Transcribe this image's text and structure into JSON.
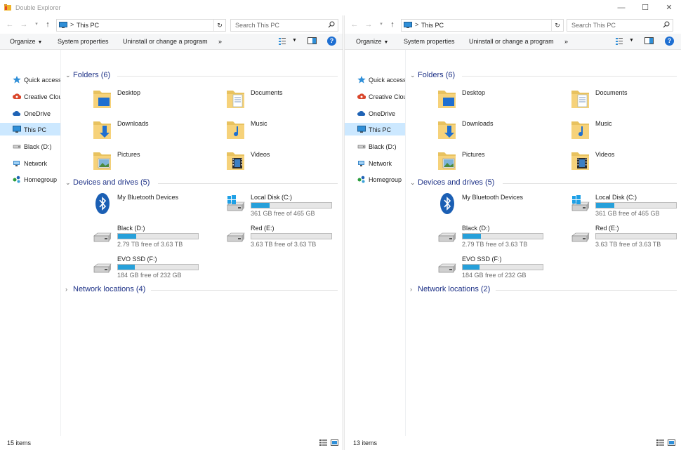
{
  "window": {
    "title": "Double Explorer",
    "controls": {
      "minimize": "—",
      "maximize": "☐",
      "close": "✕"
    }
  },
  "colors": {
    "accent": "#26a0da",
    "section_title": "#1e3287",
    "selected": "#cce8ff",
    "help": "#1e6fd2"
  },
  "panes": [
    {
      "address": {
        "location": "This PC",
        "separator": ">",
        "refresh": "↻"
      },
      "search": {
        "placeholder": "Search This PC"
      },
      "toolbar": {
        "organize": "Organize",
        "system_properties": "System properties",
        "uninstall": "Uninstall or change a program",
        "more": "»",
        "help": "?"
      },
      "nav": [
        "Quick access",
        "Creative Clou",
        "OneDrive",
        "This PC",
        "Black (D:)",
        "Network",
        "Homegroup"
      ],
      "sections": {
        "folders": "Folders (6)",
        "devices": "Devices and drives (5)",
        "network": "Network locations (4)"
      },
      "folders": [
        "Desktop",
        "Documents",
        "Downloads",
        "Music",
        "Pictures",
        "Videos"
      ],
      "devices": {
        "bluetooth": "My Bluetooth Devices",
        "c_name": "Local Disk (C:)",
        "c_free": "361 GB free of 465 GB",
        "c_used": 0.224,
        "d_name": "Black (D:)",
        "d_free": "2.79 TB free of 3.63 TB",
        "d_used": 0.231,
        "e_name": "Red (E:)",
        "e_free": "3.63 TB free of 3.63 TB",
        "e_used": 0.0,
        "f_name": "EVO SSD (F:)",
        "f_free": "184 GB free of 232 GB",
        "f_used": 0.207
      },
      "status": {
        "count": "15 items"
      }
    },
    {
      "address": {
        "location": "This PC",
        "separator": ">",
        "refresh": "↻"
      },
      "search": {
        "placeholder": "Search This PC"
      },
      "toolbar": {
        "organize": "Organize",
        "system_properties": "System properties",
        "uninstall": "Uninstall or change a program",
        "more": "»",
        "help": "?"
      },
      "nav": [
        "Quick access",
        "Creative Clou",
        "OneDrive",
        "This PC",
        "Black (D:)",
        "Network",
        "Homegroup"
      ],
      "sections": {
        "folders": "Folders (6)",
        "devices": "Devices and drives (5)",
        "network": "Network locations (2)"
      },
      "folders": [
        "Desktop",
        "Documents",
        "Downloads",
        "Music",
        "Pictures",
        "Videos"
      ],
      "devices": {
        "bluetooth": "My Bluetooth Devices",
        "c_name": "Local Disk (C:)",
        "c_free": "361 GB free of 465 GB",
        "c_used": 0.224,
        "d_name": "Black (D:)",
        "d_free": "2.79 TB free of 3.63 TB",
        "d_used": 0.231,
        "e_name": "Red (E:)",
        "e_free": "3.63 TB free of 3.63 TB",
        "e_used": 0.0,
        "f_name": "EVO SSD (F:)",
        "f_free": "184 GB free of 232 GB",
        "f_used": 0.207
      },
      "status": {
        "count": "13 items"
      }
    }
  ]
}
